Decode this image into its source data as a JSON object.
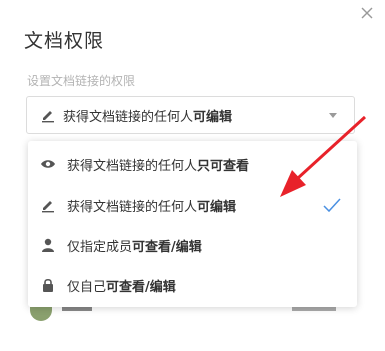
{
  "dialog": {
    "title": "文档权限",
    "subtitle": "设置文档链接的权限"
  },
  "select": {
    "icon": "pencil-icon",
    "prefix": "获得文档链接的任何人",
    "emphasis": "可编辑"
  },
  "menu": {
    "items": [
      {
        "icon": "eye-icon",
        "prefix": "获得文档链接的任何人",
        "emphasis": "只可查看",
        "selected": false
      },
      {
        "icon": "pencil-icon",
        "prefix": "获得文档链接的任何人",
        "emphasis": "可编辑",
        "selected": true
      },
      {
        "icon": "person-icon",
        "prefix": "仅指定成员",
        "emphasis": "可查看/编辑",
        "selected": false
      },
      {
        "icon": "lock-icon",
        "prefix": "仅自己",
        "emphasis": "可查看/编辑",
        "selected": false
      }
    ]
  },
  "colors": {
    "arrow": "#e8222a",
    "check": "#4a90e2"
  }
}
